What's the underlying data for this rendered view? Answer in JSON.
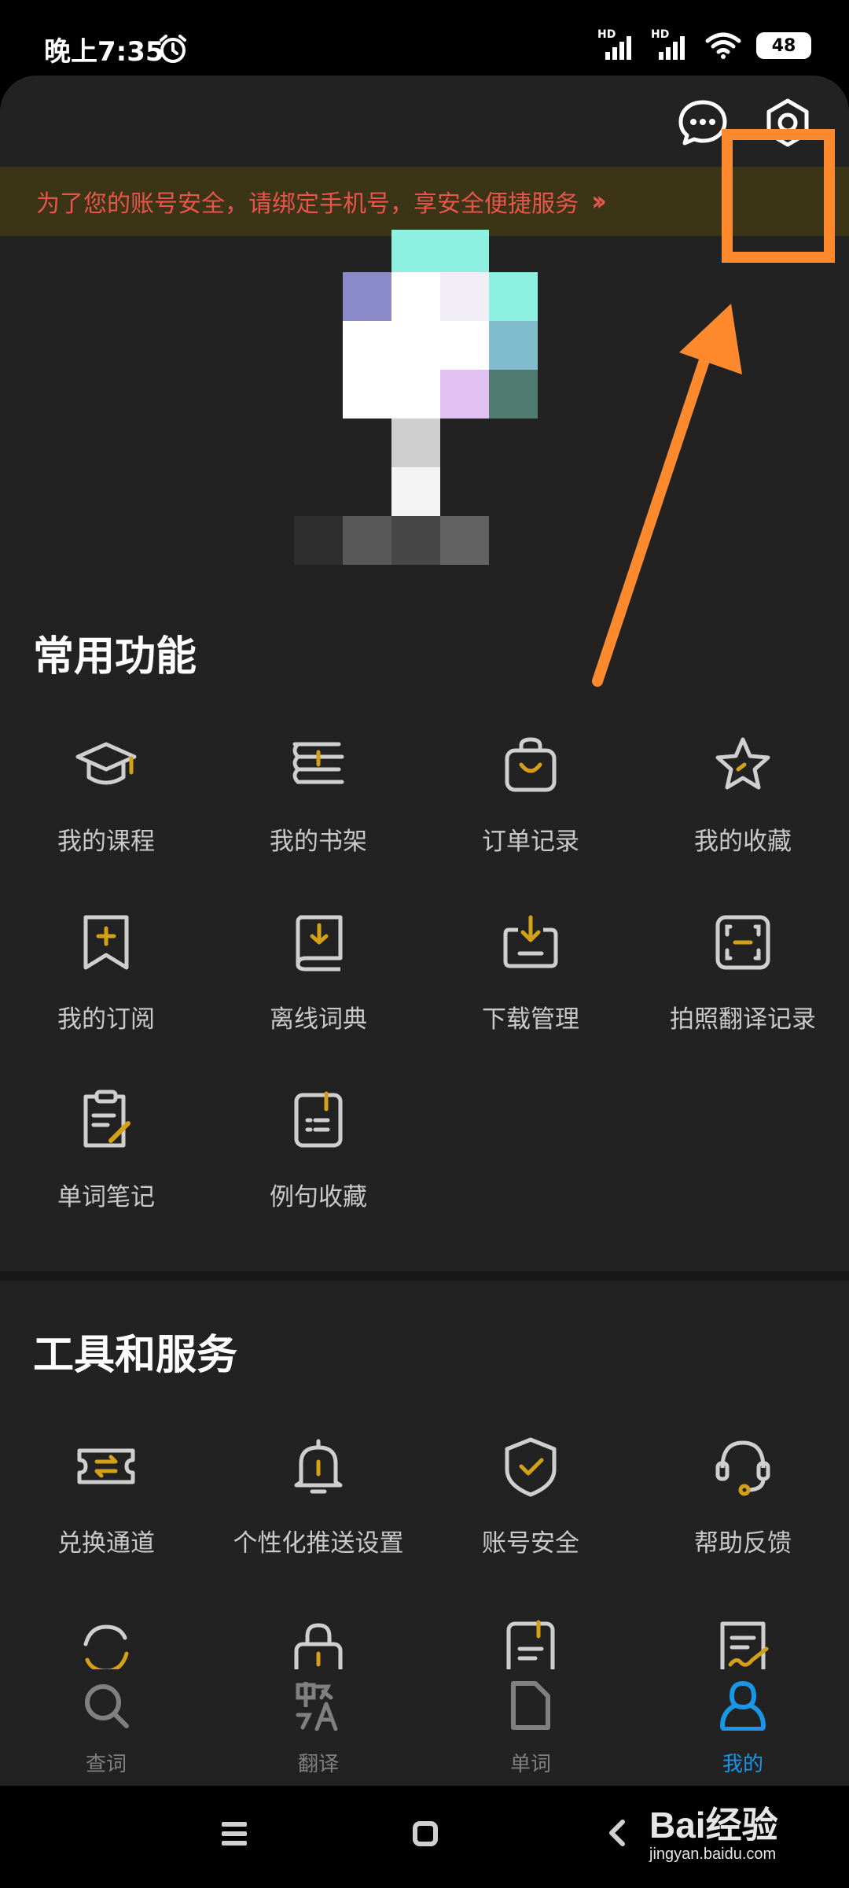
{
  "status_bar": {
    "time": "晚上7:35",
    "hd1": "HD",
    "hd2": "HD",
    "battery": "48"
  },
  "banner": {
    "text": "为了您的账号安全，请绑定手机号，享安全便捷服务"
  },
  "common": {
    "title": "常用功能",
    "items": [
      {
        "label": "我的课程",
        "icon": "graduation-cap-icon"
      },
      {
        "label": "我的书架",
        "icon": "bookshelf-icon"
      },
      {
        "label": "订单记录",
        "icon": "shopping-bag-icon"
      },
      {
        "label": "我的收藏",
        "icon": "star-icon"
      },
      {
        "label": "我的订阅",
        "icon": "bookmark-plus-icon"
      },
      {
        "label": "离线词典",
        "icon": "offline-dictionary-icon"
      },
      {
        "label": "下载管理",
        "icon": "download-tray-icon"
      },
      {
        "label": "拍照翻译记录",
        "icon": "scan-frame-icon"
      },
      {
        "label": "单词笔记",
        "icon": "notepad-pencil-icon"
      },
      {
        "label": "例句收藏",
        "icon": "document-list-icon"
      }
    ]
  },
  "tools": {
    "title": "工具和服务",
    "items": [
      {
        "label": "兑换通道",
        "icon": "exchange-ticket-icon"
      },
      {
        "label": "个性化推送设置",
        "icon": "bell-icon"
      },
      {
        "label": "账号安全",
        "icon": "shield-check-icon"
      },
      {
        "label": "帮助反馈",
        "icon": "headset-icon"
      }
    ]
  },
  "tabbar": {
    "tabs": [
      {
        "label": "查词",
        "icon": "search-icon"
      },
      {
        "label": "翻译",
        "icon": "translate-icon"
      },
      {
        "label": "单词",
        "icon": "document-icon"
      },
      {
        "label": "我的",
        "icon": "person-icon"
      }
    ],
    "active_index": 3
  },
  "watermark": {
    "logo": "Bai经验",
    "url": "jingyan.baidu.com"
  },
  "colors": {
    "accent_orange": "#ff8a2e",
    "icon_gold": "#d4a017",
    "active_blue": "#1a96e8",
    "banner_text": "#e8554a"
  }
}
